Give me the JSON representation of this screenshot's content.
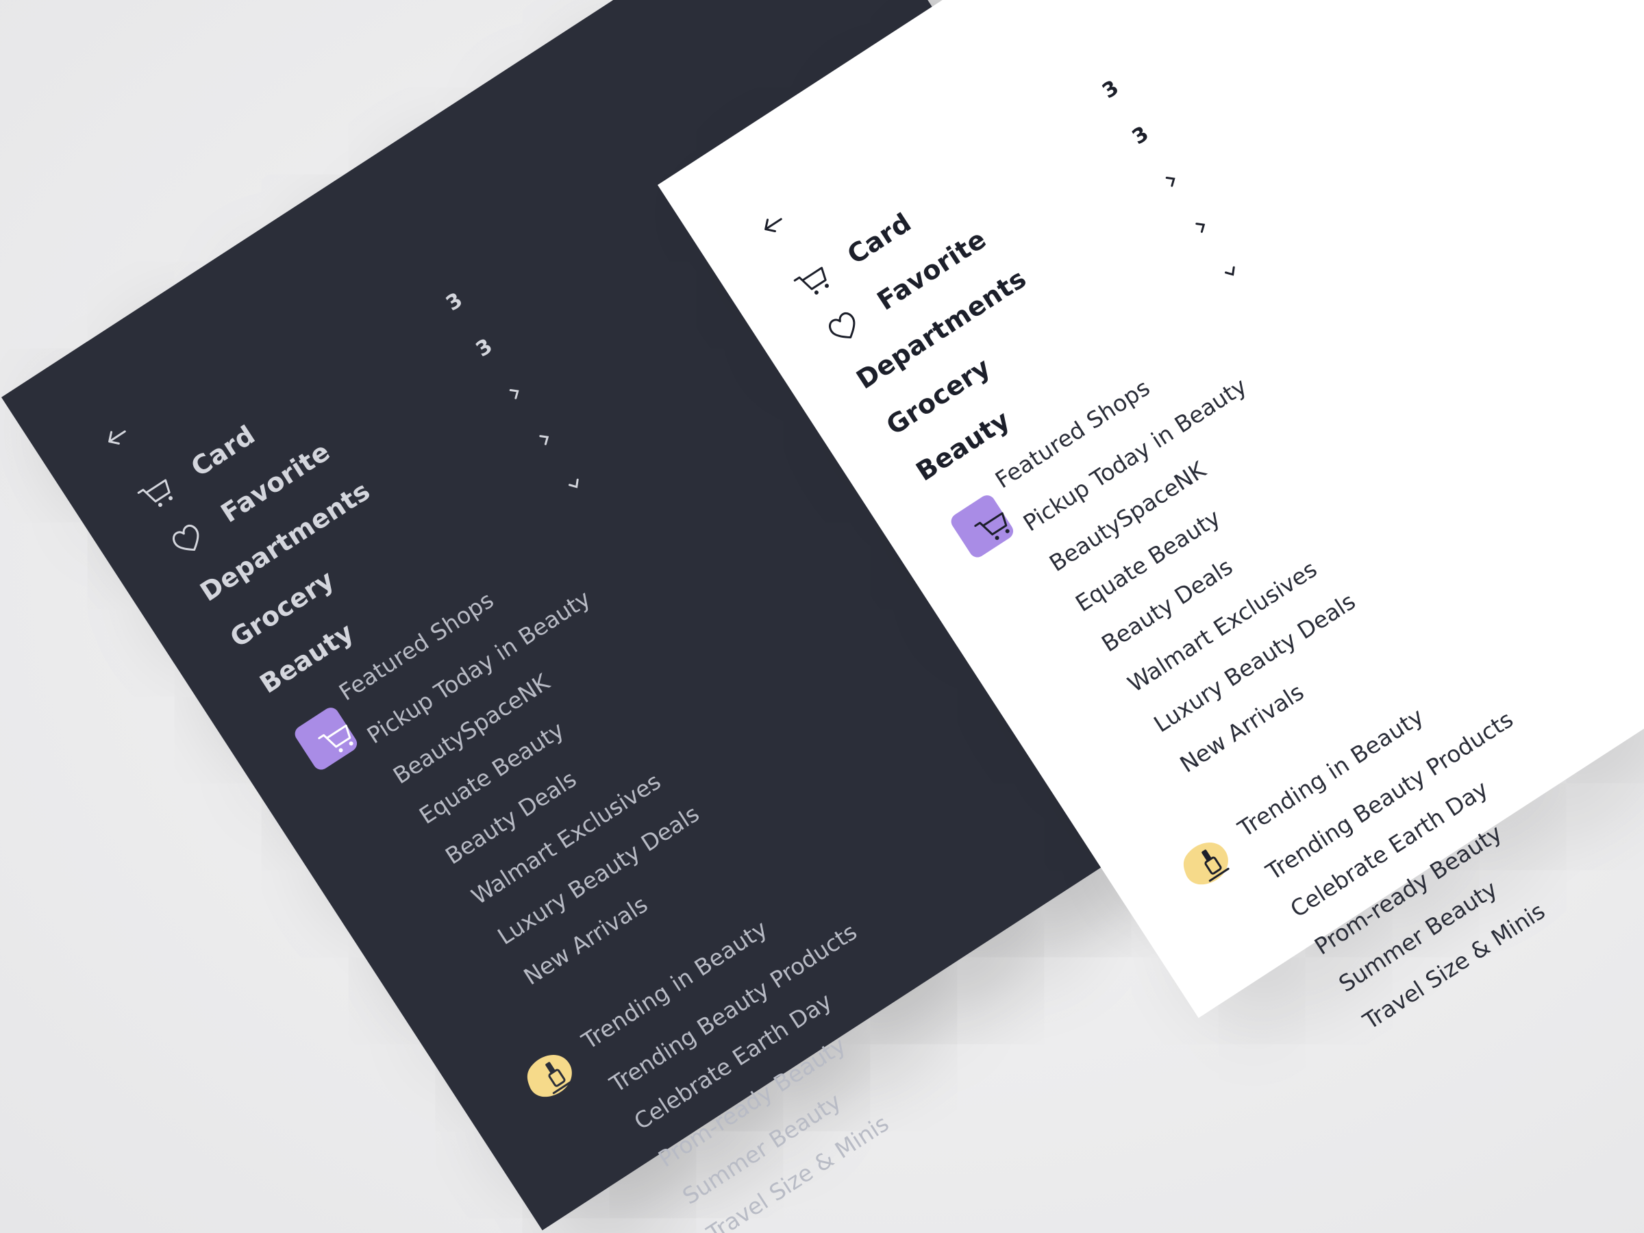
{
  "colors": {
    "dark_bg": "#2b2e39",
    "light_bg": "#ffffff",
    "accent_purple": "#a98ce6",
    "accent_yellow": "#f6da8a"
  },
  "nav": {
    "back_icon": "arrow-left-icon",
    "items": [
      {
        "label": "Card",
        "icon": "cart-icon",
        "count": "3"
      },
      {
        "label": "Favorite",
        "icon": "heart-icon",
        "count": "3"
      },
      {
        "label": "Departments",
        "icon": "chevron-right-icon"
      },
      {
        "label": "Grocery",
        "icon": "chevron-right-icon"
      },
      {
        "label": "Beauty",
        "icon": "chevron-down-icon"
      }
    ]
  },
  "featured": {
    "title": "Featured Shops",
    "icon": "cart-icon",
    "items": [
      "Pickup Today in Beauty",
      "BeautySpaceNK",
      "Equate Beauty",
      "Beauty Deals",
      "Walmart Exclusives",
      "Luxury Beauty Deals",
      "New Arrivals"
    ]
  },
  "trending": {
    "title": "Trending in Beauty",
    "icon": "nail-polish-icon",
    "items": [
      "Trending Beauty Products",
      "Celebrate Earth Day",
      "Prom-ready Beauty",
      "Summer Beauty",
      "Travel Size & Minis"
    ]
  }
}
